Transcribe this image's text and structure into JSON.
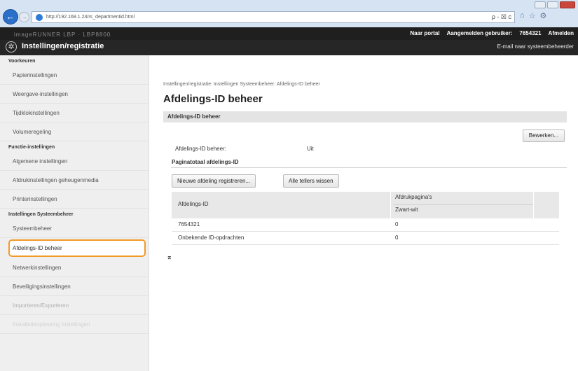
{
  "browser": {
    "url": "http://192.168.1.24/rs_departmentid.html",
    "search_controls": "ρ - ☒ c"
  },
  "header": {
    "blurred_left": "imageRUNNER  LBP · LBP8800",
    "links": {
      "portal": "Naar portal",
      "login_user_label": "Aangemelden gebruiker:",
      "login_user_value": "7654321",
      "logout": "Afmelden"
    },
    "app_title": "Instellingen/registratie",
    "mail_admin": "E-mail naar systeembeheerder"
  },
  "sidebar": {
    "sections": [
      {
        "title": "Voorkeuren",
        "items": [
          {
            "label": "Papierinstellingen"
          },
          {
            "label": "Weergave-instellingen"
          },
          {
            "label": "Tijdklokinstellingen"
          },
          {
            "label": "Volumeregeling"
          }
        ]
      },
      {
        "title": "Functie-instellingen",
        "items": [
          {
            "label": "Algemene instellingen"
          },
          {
            "label": "Afdrukinstellingen geheugenmedia"
          },
          {
            "label": "Printerinstellingen"
          }
        ]
      },
      {
        "title": "Instellingen Systeembeheer",
        "items": [
          {
            "label": "Systeembeheer"
          },
          {
            "label": "Afdelings-ID beheer"
          },
          {
            "label": "Netwerkinstellingen"
          },
          {
            "label": "Beveiligingsinstellingen"
          },
          {
            "label": "Importeren/Exporteren"
          },
          {
            "label": "Installatieoplossing Instellingen"
          }
        ]
      }
    ]
  },
  "main": {
    "breadcrumb": "Instellingen/registratie: Instellingen Systeembeheer: Afdelings-ID beheer",
    "page_title": "Afdelings-ID beheer",
    "section_title": "Afdelings-ID beheer",
    "edit_button": "Bewerken...",
    "setting_label": "Afdelings-ID beheer:",
    "setting_value": "Uit",
    "counter_title": "Paginatotaal afdelings-ID",
    "register_button": "Nieuwe afdeling registreren...",
    "clear_button": "Alle tellers wissen",
    "table": {
      "col_id": "Afdelings-ID",
      "col_pages": "Afdrukpagina's",
      "col_bw": "Zwart-wit",
      "rows": [
        {
          "id": "7654321",
          "bw": "0"
        },
        {
          "id": "Onbekende ID-opdrachten",
          "bw": "0"
        }
      ]
    },
    "to_top": "⌅"
  }
}
